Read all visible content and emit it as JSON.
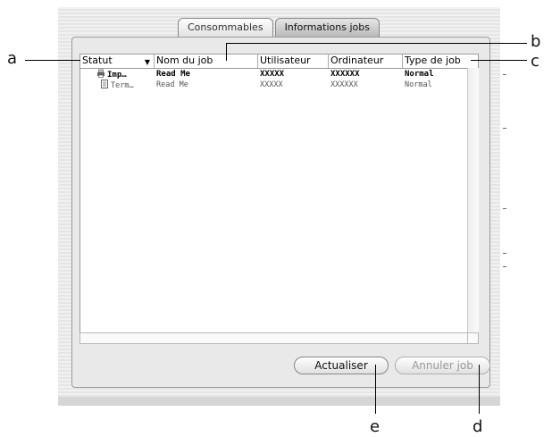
{
  "tabs": [
    {
      "label": "Consommables",
      "active": false
    },
    {
      "label": "Informations jobs",
      "active": true
    }
  ],
  "list": {
    "columns": [
      "Statut",
      "Nom du job",
      "Utilisateur",
      "Ordinateur",
      "Type de job"
    ],
    "rows": [
      {
        "status": "Imp…",
        "status_icon": "printer-icon",
        "job": "Read Me",
        "user": "XXXXX",
        "computer": "XXXXXX",
        "type": "Normal",
        "style": "bold"
      },
      {
        "status": "Term…",
        "status_icon": "document-icon",
        "job": "Read Me",
        "user": "XXXXX",
        "computer": "XXXXXX",
        "type": "Normal",
        "style": "normal"
      }
    ]
  },
  "buttons": {
    "refresh": "Actualiser",
    "cancel_job": "Annuler job"
  },
  "callouts": {
    "a": "a",
    "b": "b",
    "c": "c",
    "d": "d",
    "e": "e"
  }
}
